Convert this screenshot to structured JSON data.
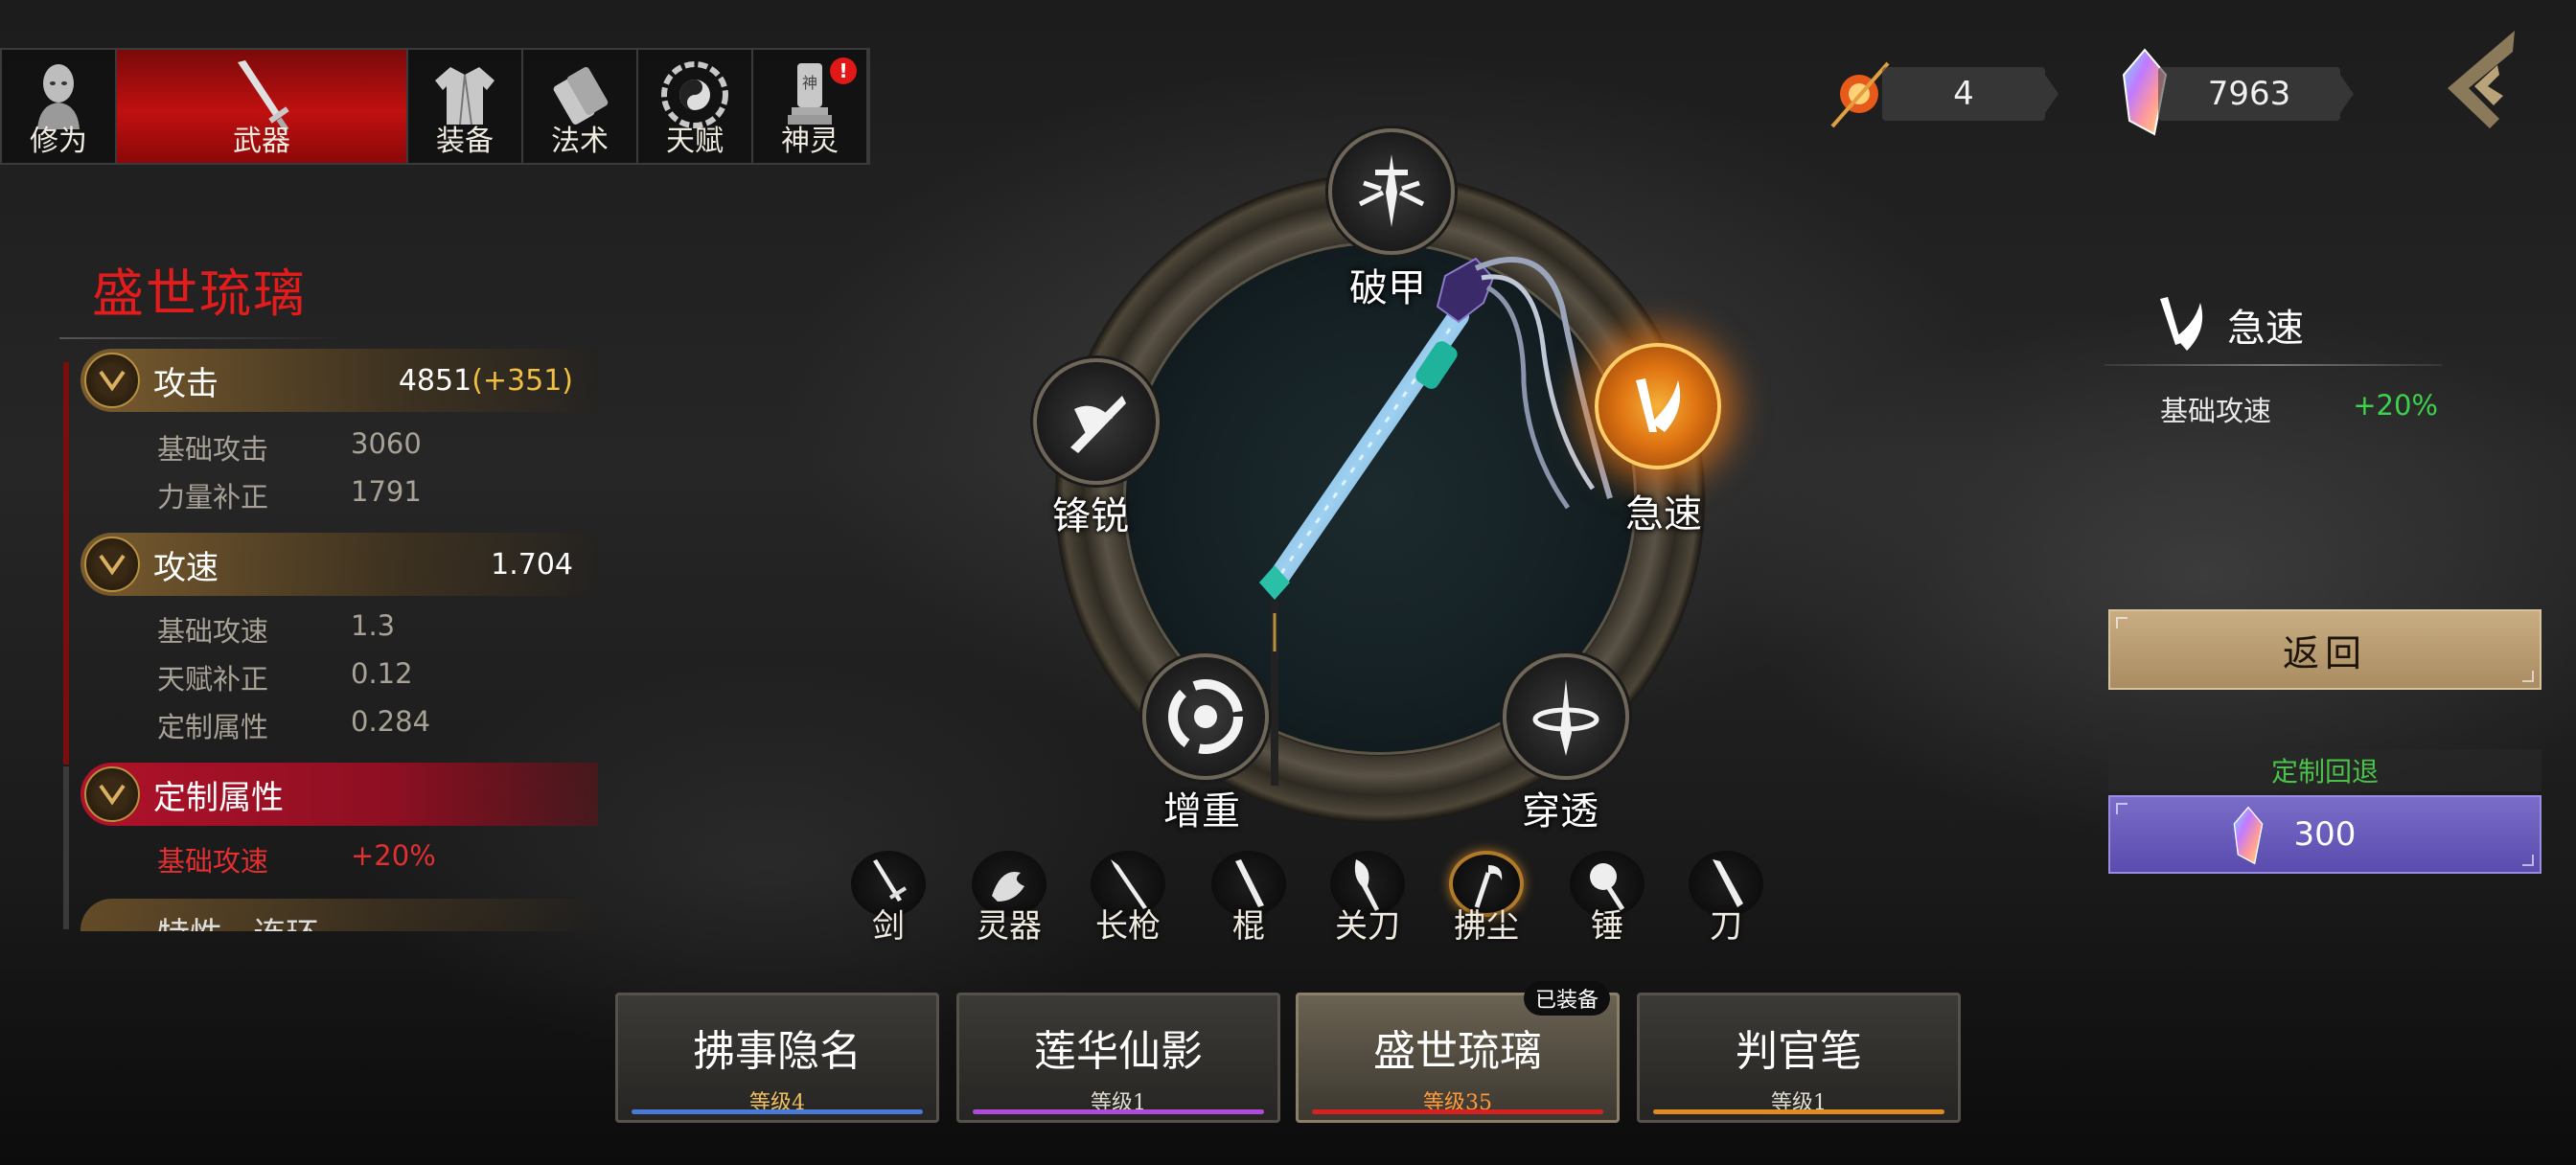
{
  "tabs": [
    {
      "label": "修为",
      "icon": "cultivator-icon",
      "active": false,
      "alert": false
    },
    {
      "label": "武器",
      "icon": "sword-icon",
      "active": true,
      "alert": false
    },
    {
      "label": "装备",
      "icon": "robe-icon",
      "active": false,
      "alert": false
    },
    {
      "label": "法术",
      "icon": "scroll-icon",
      "active": false,
      "alert": false
    },
    {
      "label": "天赋",
      "icon": "bagua-icon",
      "active": false,
      "alert": false
    },
    {
      "label": "神灵",
      "icon": "tablet-icon",
      "active": false,
      "alert": true,
      "alert_mark": "!"
    }
  ],
  "currency": {
    "orb": {
      "icon": "fire-orb-icon",
      "value": "4"
    },
    "crystal": {
      "icon": "rainbow-crystal-icon",
      "value": "7963"
    }
  },
  "left_panel": {
    "weapon_name": "盛世琉璃",
    "stats": [
      {
        "name": "攻击",
        "value": "4851",
        "bonus": "(+351)",
        "rows": [
          {
            "k": "基础攻击",
            "v": "3060"
          },
          {
            "k": "力量补正",
            "v": "1791"
          }
        ]
      },
      {
        "name": "攻速",
        "value": "1.704",
        "bonus": "",
        "rows": [
          {
            "k": "基础攻速",
            "v": "1.3"
          },
          {
            "k": "天赋补正",
            "v": "0.12"
          },
          {
            "k": "定制属性",
            "v": "0.284"
          }
        ]
      },
      {
        "name": "定制属性",
        "value": "",
        "bonus": "",
        "rows": [
          {
            "k": "基础攻速",
            "v": "+20%"
          }
        ]
      }
    ],
    "cut_row": "特性 · 连环"
  },
  "ring": {
    "nodes": [
      {
        "label": "破甲",
        "icon": "armor-break-icon",
        "active": false
      },
      {
        "label": "锋锐",
        "icon": "sharp-blade-icon",
        "active": false
      },
      {
        "label": "急速",
        "icon": "swift-blade-icon",
        "active": true
      },
      {
        "label": "增重",
        "icon": "vortex-icon",
        "active": false
      },
      {
        "label": "穿透",
        "icon": "pierce-sword-icon",
        "active": false
      }
    ],
    "center_item": "horsetail-whisk-image"
  },
  "weapon_types": [
    {
      "label": "剑",
      "icon": "sword-icon",
      "active": false
    },
    {
      "label": "灵器",
      "icon": "dragon-icon",
      "active": false
    },
    {
      "label": "长枪",
      "icon": "spear-icon",
      "active": false
    },
    {
      "label": "棍",
      "icon": "staff-icon",
      "active": false
    },
    {
      "label": "关刀",
      "icon": "glaive-icon",
      "active": false
    },
    {
      "label": "拂尘",
      "icon": "whisk-icon",
      "active": true
    },
    {
      "label": "锤",
      "icon": "hammer-icon",
      "active": false
    },
    {
      "label": "刀",
      "icon": "blade-icon",
      "active": false
    }
  ],
  "weapon_cards": [
    {
      "name": "拂事隐名",
      "level": "等级4",
      "bar_color": "#4a7ad8",
      "active": false
    },
    {
      "name": "莲华仙影",
      "level": "等级1",
      "bar_color": "#b04ad8",
      "active": false
    },
    {
      "name": "盛世琉璃",
      "level": "等级35",
      "bar_color": "#d82020",
      "active": true,
      "badge": "已装备"
    },
    {
      "name": "判官笔",
      "level": "等级1",
      "bar_color": "#e08a20",
      "active": false
    }
  ],
  "right_panel": {
    "title": "急速",
    "row_label": "基础攻速",
    "row_value": "+20%",
    "back_button": "返回",
    "reset_label": "定制回退",
    "reset_cost": "300"
  },
  "colors": {
    "accent_red": "#e21c1c",
    "gold": "#b8913e",
    "green": "#3cd24c",
    "purple": "#5a4cae"
  }
}
